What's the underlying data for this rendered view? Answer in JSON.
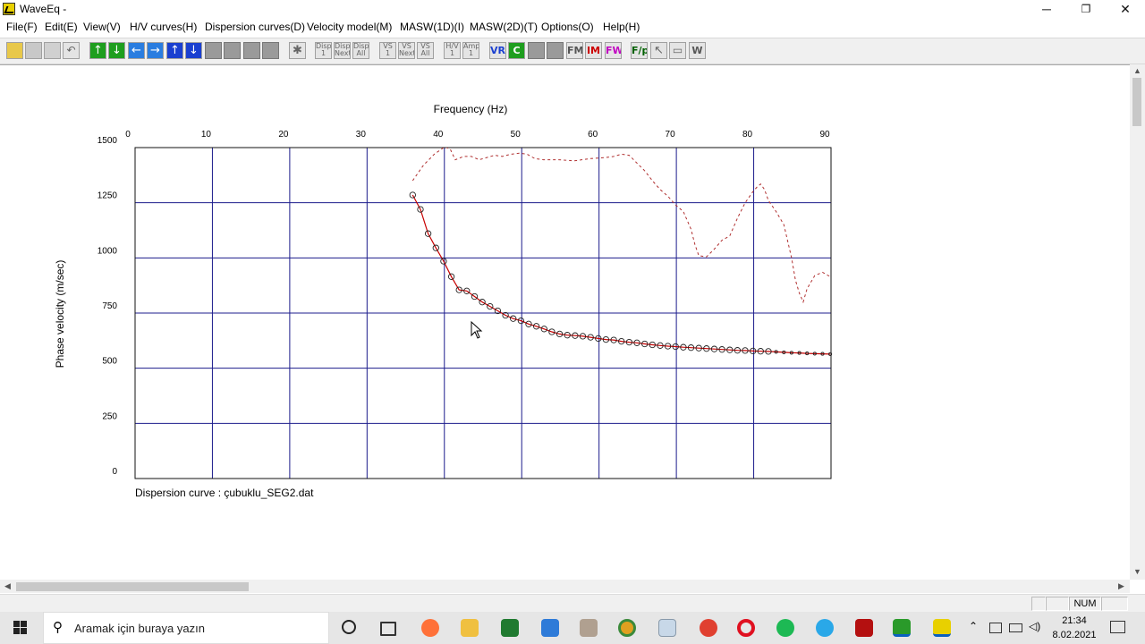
{
  "window": {
    "title": "WaveEq -",
    "minimize": "─",
    "restore": "❐",
    "close": "✕"
  },
  "menu": [
    "File(F)",
    "Edit(E)",
    "View(V)",
    "H/V curves(H)",
    "Dispersion curves(D)",
    "Velocity model(M)",
    "MASW(1D)(I)",
    "MASW(2D)(T)",
    "Options(O)",
    "Help(H)"
  ],
  "toolbar": {
    "dispersion_buttons": [
      "Disp 1",
      "Disp Next",
      "Disp All"
    ],
    "vs_buttons": [
      "VS 1",
      "VS Next",
      "VS All"
    ],
    "hv_buttons": [
      "H/V 1",
      "Amp 1"
    ],
    "text_buttons": [
      "VR",
      "C",
      "FM",
      "IM",
      "FW",
      "F/p",
      "W"
    ]
  },
  "chart_data": {
    "type": "scatter",
    "xlabel": "Frequency (Hz)",
    "ylabel": "Phase velocity (m/sec)",
    "xlim": [
      0,
      90
    ],
    "ylim": [
      0,
      1500
    ],
    "xticks": [
      0,
      10,
      20,
      30,
      40,
      50,
      60,
      70,
      80,
      90
    ],
    "yticks": [
      0,
      250,
      500,
      750,
      1000,
      1250,
      1500
    ],
    "grid": true,
    "colors": {
      "grid": "#1c1c8c",
      "picked_line": "#c80000",
      "markers": "#222222",
      "dashed": "#b03030"
    },
    "series": [
      {
        "x": [
          35.9,
          36.9,
          37.9,
          38.9,
          39.9,
          40.9,
          41.9,
          42.9,
          43.9,
          44.9,
          45.9,
          46.9,
          47.9,
          48.9,
          49.9,
          50.9,
          51.9,
          52.9,
          53.9,
          54.9,
          55.9,
          56.9,
          57.9,
          58.9,
          59.9,
          60.9,
          61.9,
          62.9,
          63.9,
          64.9,
          65.9,
          66.9,
          67.9,
          68.9,
          69.9,
          70.9,
          71.9,
          72.9,
          73.9,
          74.9,
          75.9,
          76.9,
          77.9,
          78.9,
          79.9,
          80.9,
          81.9,
          82.9,
          83.9,
          84.9,
          85.9,
          86.9,
          87.9,
          88.9,
          89.9
        ],
        "y": [
          1285,
          1220,
          1110,
          1045,
          985,
          915,
          855,
          850,
          825,
          800,
          780,
          760,
          740,
          725,
          715,
          700,
          690,
          678,
          665,
          655,
          650,
          648,
          645,
          640,
          635,
          630,
          628,
          622,
          618,
          615,
          610,
          606,
          603,
          600,
          598,
          595,
          593,
          591,
          589,
          587,
          585,
          583,
          581,
          580,
          578,
          577,
          576,
          574,
          572,
          570,
          569,
          567,
          566,
          565,
          564
        ]
      },
      {
        "x": [
          35.9,
          37.3,
          38.7,
          40.1,
          40.8,
          41.4,
          42.5,
          43.5,
          44.5,
          45.5,
          46.5,
          47.5,
          48.6,
          49.7,
          50.7,
          51.7,
          52.8,
          54.8,
          56.8,
          58.9,
          60.9,
          61.9,
          62.9,
          63.9,
          64.9,
          65.9,
          66.9,
          67.9,
          68.9,
          69.9,
          70.9,
          71.9,
          72.4,
          72.9,
          73.9,
          74.9,
          75.9,
          76.9,
          77.9,
          78.9,
          79.9,
          80.4,
          80.9,
          81.4,
          81.9,
          82.9,
          83.9,
          84.9,
          85.4,
          85.9,
          86.4,
          86.9,
          87.9,
          88.9,
          89.9
        ],
        "y": [
          1350,
          1420,
          1470,
          1505,
          1490,
          1445,
          1460,
          1460,
          1445,
          1455,
          1465,
          1460,
          1470,
          1475,
          1470,
          1450,
          1445,
          1445,
          1440,
          1450,
          1455,
          1460,
          1470,
          1465,
          1430,
          1395,
          1350,
          1310,
          1280,
          1240,
          1210,
          1130,
          1060,
          1010,
          1005,
          1040,
          1080,
          1100,
          1180,
          1250,
          1300,
          1320,
          1335,
          1310,
          1260,
          1210,
          1150,
          1000,
          900,
          840,
          800,
          860,
          920,
          935,
          915
        ]
      }
    ]
  },
  "chart_caption": "Dispersion curve : çubuklu_SEG2.dat",
  "status": {
    "num": "NUM"
  },
  "taskbar": {
    "search_placeholder": "Aramak için buraya yazın",
    "time": "21:34",
    "date": "8.02.2021"
  }
}
